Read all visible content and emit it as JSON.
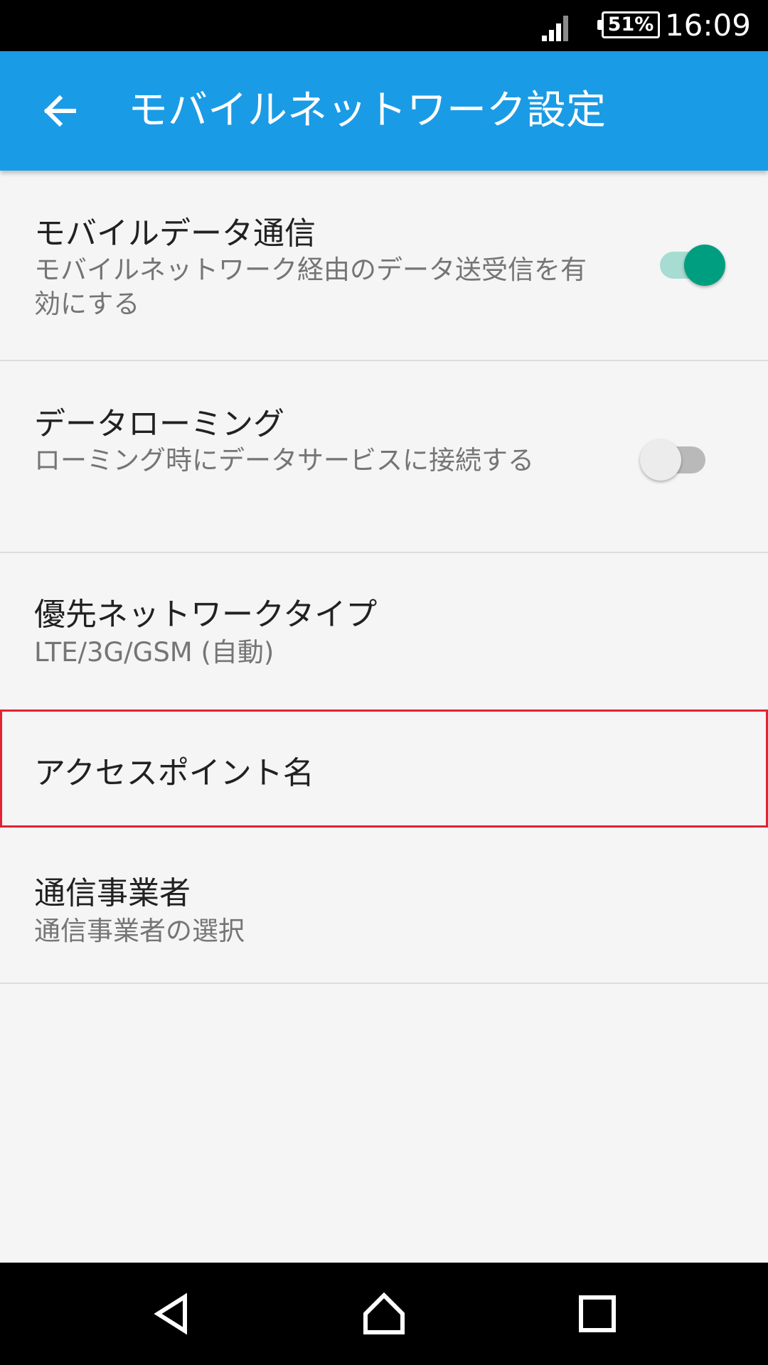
{
  "status_bar": {
    "battery": "51%",
    "time": "16:09"
  },
  "toolbar": {
    "title": "モバイルネットワーク設定"
  },
  "settings": [
    {
      "title": "モバイルデータ通信",
      "summary": "モバイルネットワーク経由のデータ送受信を有効にする",
      "switch": "on"
    },
    {
      "title": "データローミング",
      "summary": "ローミング時にデータサービスに接続する",
      "switch": "off"
    },
    {
      "title": "優先ネットワークタイプ",
      "summary": "LTE/3G/GSM (自動)"
    },
    {
      "title": "アクセスポイント名",
      "highlighted": true
    },
    {
      "title": "通信事業者",
      "summary": "通信事業者の選択"
    }
  ],
  "colors": {
    "toolbar": "#1a9be6",
    "switch_on_thumb": "#009e80",
    "switch_on_track": "#a6dcd2",
    "highlight_border": "#e32232"
  },
  "icons": {
    "back": "arrow-left-icon",
    "signal": "cell-signal-icon",
    "battery": "battery-icon",
    "nav_back": "triangle-back-icon",
    "nav_home": "house-home-icon",
    "nav_recent": "square-recents-icon"
  }
}
